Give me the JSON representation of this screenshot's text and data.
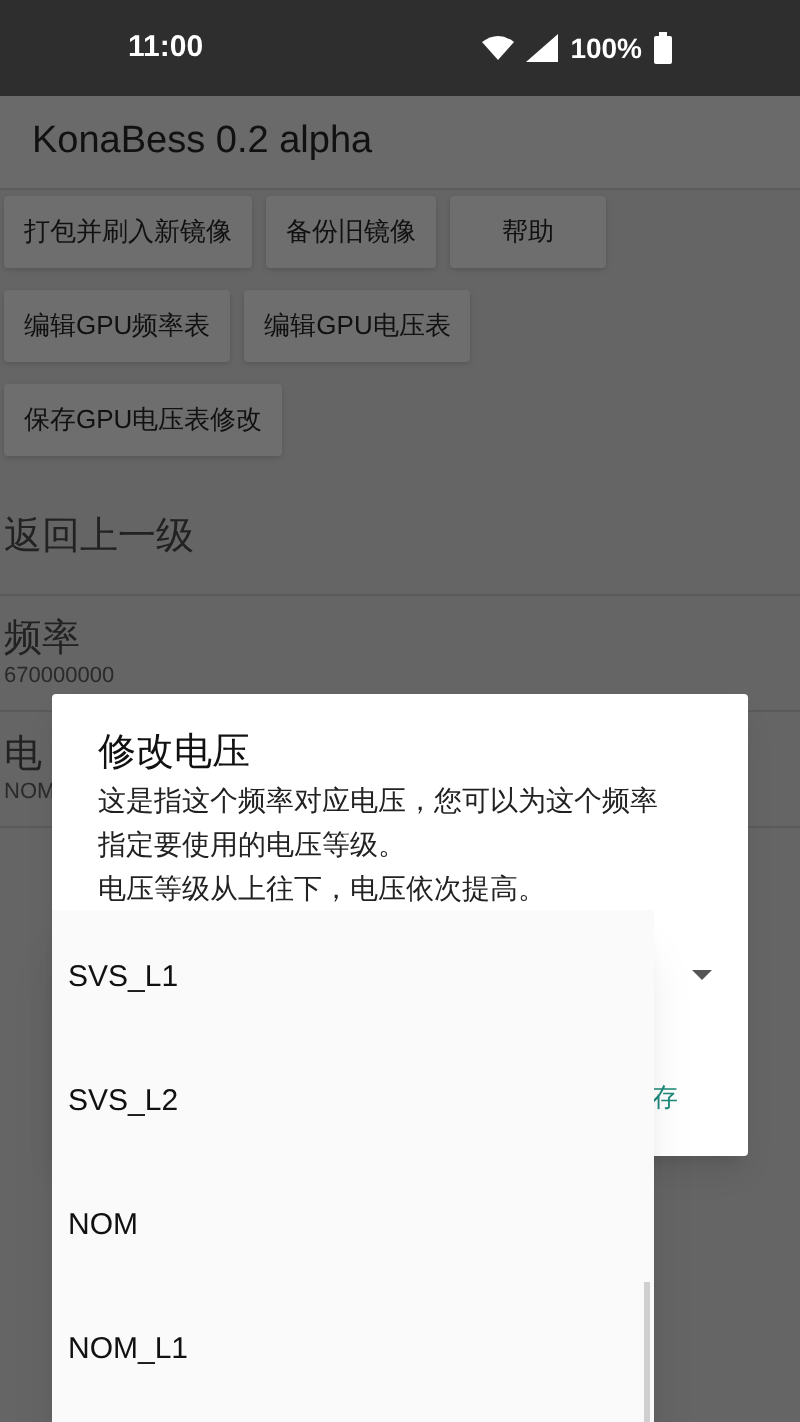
{
  "status_bar": {
    "time": "11:00",
    "battery": "100%"
  },
  "app_bar": {
    "title": "KonaBess 0.2 alpha"
  },
  "toolbar_rows": [
    [
      "打包并刷入新镜像",
      "备份旧镜像",
      "帮助"
    ],
    [
      "编辑GPU频率表",
      "编辑GPU电压表"
    ],
    [
      "保存GPU电压表修改"
    ]
  ],
  "list": [
    {
      "title": "返回上一级"
    },
    {
      "title": "频率",
      "subtitle": "670000000"
    },
    {
      "title": "电",
      "subtitle": "NOM"
    }
  ],
  "dialog": {
    "title": "修改电压",
    "message_lines": [
      "这是指这个频率对应电压，您可以为这个频率指定要使用的电压等级。",
      "电压等级从上往下，电压依次提高。"
    ],
    "button": "存"
  },
  "dropdown": {
    "options": [
      "SVS_L1",
      "SVS_L2",
      "NOM",
      "NOM_L1"
    ]
  }
}
